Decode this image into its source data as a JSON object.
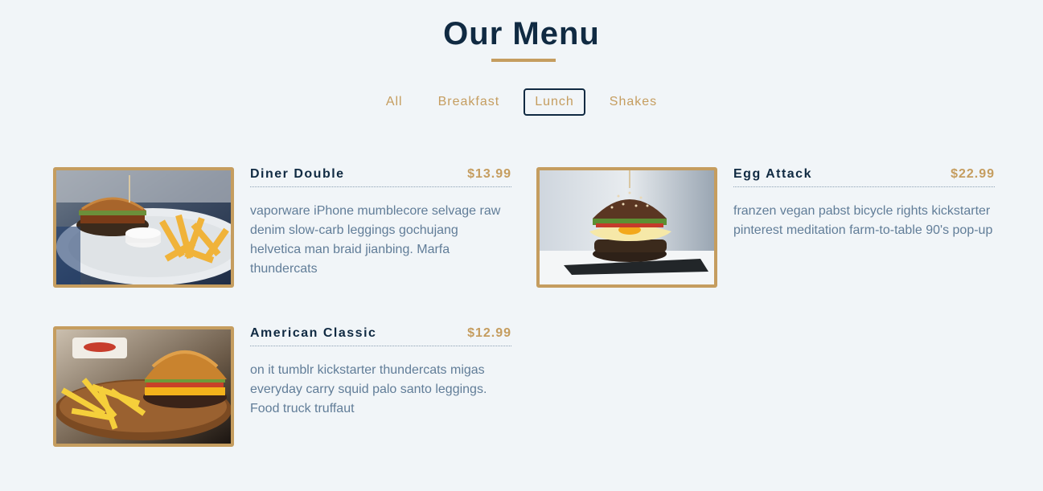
{
  "section": {
    "title": "Our Menu"
  },
  "filters": [
    {
      "label": "All",
      "active": false
    },
    {
      "label": "Breakfast",
      "active": false
    },
    {
      "label": "Lunch",
      "active": true
    },
    {
      "label": "Shakes",
      "active": false
    }
  ],
  "items": [
    {
      "name": "Diner Double",
      "price": "$13.99",
      "desc": "vaporware iPhone mumblecore selvage raw denim slow-carb leggings gochujang helvetica man braid jianbing. Marfa thundercats"
    },
    {
      "name": "Egg Attack",
      "price": "$22.99",
      "desc": "franzen vegan pabst bicycle rights kickstarter pinterest meditation farm-to-table 90's pop-up"
    },
    {
      "name": "American Classic",
      "price": "$12.99",
      "desc": "on it tumblr kickstarter thundercats migas everyday carry squid palo santo leggings. Food truck truffaut"
    }
  ],
  "colors": {
    "background": "#f1f5f8",
    "accent": "#c59d5f",
    "heading": "#102a42",
    "text": "#617d98"
  }
}
